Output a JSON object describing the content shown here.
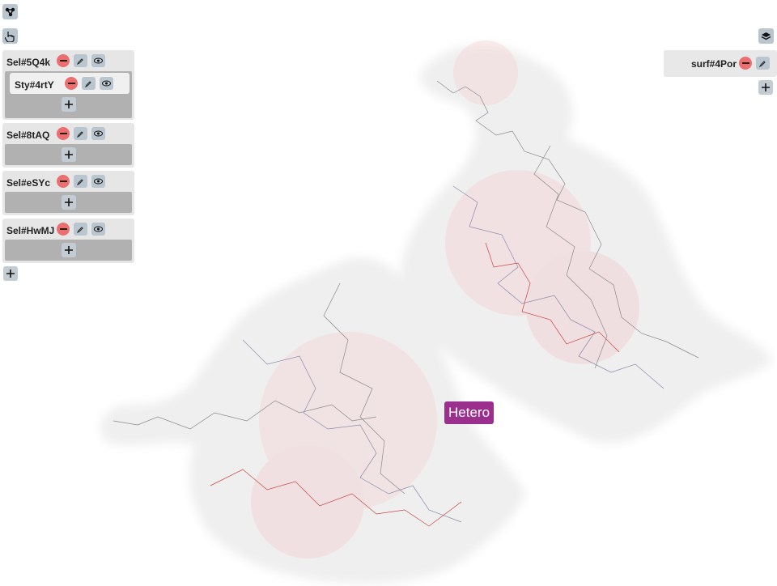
{
  "toolbar": {
    "top_icon": "molecule-icon",
    "pointer_icon": "hand-pointer-icon",
    "layers_icon": "layers-icon"
  },
  "selections": [
    {
      "label": "Sel#5Q4k",
      "styles": [
        {
          "label": "Sty#4rtY"
        }
      ]
    },
    {
      "label": "Sel#8tAQ",
      "styles": []
    },
    {
      "label": "Sel#eSYc",
      "styles": []
    },
    {
      "label": "Sel#HwMJ",
      "styles": []
    }
  ],
  "surfaces": [
    {
      "label": "surf#4Por"
    }
  ],
  "viewer": {
    "label": "Hetero"
  },
  "colors": {
    "remove": "#ec6f6f",
    "button": "#b9c6cf",
    "panel": "#e6e6e6",
    "label_bg": "#9b2f8e"
  }
}
